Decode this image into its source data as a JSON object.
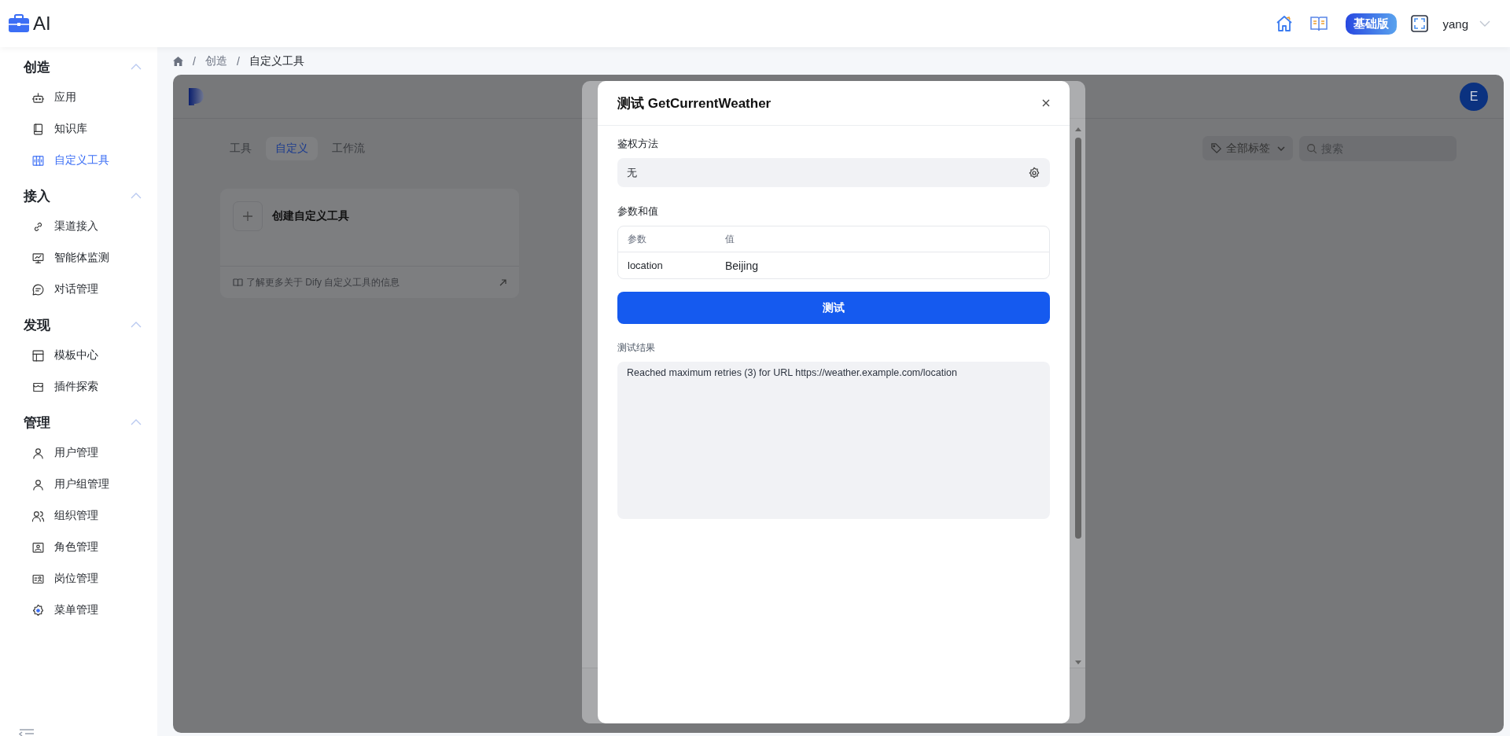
{
  "app": {
    "logo_text": "AI"
  },
  "header": {
    "plan_badge": "基础版",
    "user": "yang"
  },
  "sidebar": {
    "sections": [
      {
        "title": "创造",
        "expanded": true,
        "items": [
          {
            "label": "应用",
            "selected": false
          },
          {
            "label": "知识库",
            "selected": false
          },
          {
            "label": "自定义工具",
            "selected": true
          }
        ]
      },
      {
        "title": "接入",
        "expanded": true,
        "items": [
          {
            "label": "渠道接入",
            "selected": false
          },
          {
            "label": "智能体监测",
            "selected": false
          },
          {
            "label": "对话管理",
            "selected": false
          }
        ]
      },
      {
        "title": "发现",
        "expanded": true,
        "items": [
          {
            "label": "模板中心",
            "selected": false
          },
          {
            "label": "插件探索",
            "selected": false
          }
        ]
      },
      {
        "title": "管理",
        "expanded": true,
        "items": [
          {
            "label": "用户管理",
            "selected": false
          },
          {
            "label": "用户组管理",
            "selected": false
          },
          {
            "label": "组织管理",
            "selected": false
          },
          {
            "label": "角色管理",
            "selected": false
          },
          {
            "label": "岗位管理",
            "selected": false
          },
          {
            "label": "菜单管理",
            "selected": false
          }
        ]
      }
    ]
  },
  "breadcrumb": {
    "separator": "/",
    "items": [
      "创造",
      "自定义工具"
    ]
  },
  "panel": {
    "avatar": "E",
    "tabs": [
      {
        "label": "工具",
        "selected": false
      },
      {
        "label": "自定义",
        "selected": true
      },
      {
        "label": "工作流",
        "selected": false
      }
    ],
    "tag_filter": "全部标签",
    "search": {
      "placeholder": "搜索"
    },
    "create_card": {
      "title": "创建自定义工具",
      "link": "了解更多关于 Dify 自定义工具的信息"
    }
  },
  "dialog": {
    "title": "测试 GetCurrentWeather",
    "auth_label": "鉴权方法",
    "auth_value": "无",
    "params_label": "参数和值",
    "columns": [
      "参数",
      "值"
    ],
    "rows": [
      {
        "param": "location",
        "value": "Beijing"
      }
    ],
    "button": "测试",
    "result_label": "测试结果",
    "result": "Reached maximum retries (3) for URL https://weather.example.com/location"
  }
}
